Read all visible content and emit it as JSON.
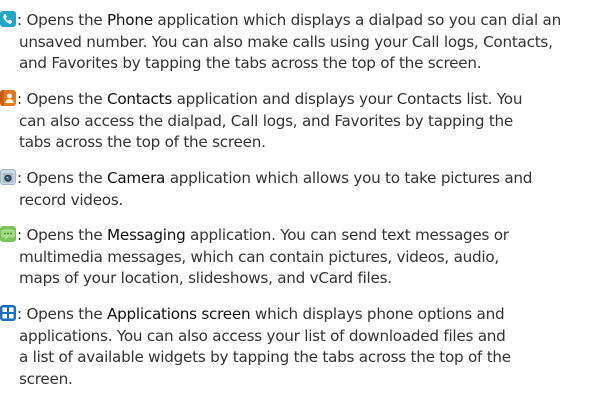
{
  "entries": [
    {
      "icon": "phone-icon",
      "lines": [
        {
          "pre": ": Opens the ",
          "bold": "Phone",
          "post": " application which displays a dialpad so you can dial an"
        },
        {
          "text": "unsaved number. You can also make calls using your Call logs, Contacts,"
        },
        {
          "text": "and Favorites by tapping the tabs across the top of the screen."
        }
      ]
    },
    {
      "icon": "contacts-icon",
      "lines": [
        {
          "pre": ": Opens the ",
          "bold": "Contacts",
          "post": " application and displays your Contacts list. You"
        },
        {
          "text": "can also access the dialpad, Call logs, and Favorites by tapping the"
        },
        {
          "text": "tabs across the top of the screen."
        }
      ]
    },
    {
      "icon": "camera-icon",
      "lines": [
        {
          "pre": ": Opens the ",
          "bold": "Camera",
          "post": " application which allows you to take pictures and"
        },
        {
          "text": "record videos."
        }
      ]
    },
    {
      "icon": "messaging-icon",
      "lines": [
        {
          "pre": ": Opens the ",
          "bold": "Messaging",
          "post": " application. You can send text messages or"
        },
        {
          "text": "multimedia messages, which can contain pictures, videos, audio,"
        },
        {
          "text": "maps of your location, slideshows, and vCard files."
        }
      ]
    },
    {
      "icon": "applications-icon",
      "lines": [
        {
          "pre": ": Opens the ",
          "bold": "Applications screen",
          "post": " which displays phone options and"
        },
        {
          "text": "applications. You can also access your list of downloaded files and"
        },
        {
          "text": "a list of available widgets by tapping the tabs across the top of the"
        },
        {
          "text": "screen."
        }
      ]
    }
  ]
}
